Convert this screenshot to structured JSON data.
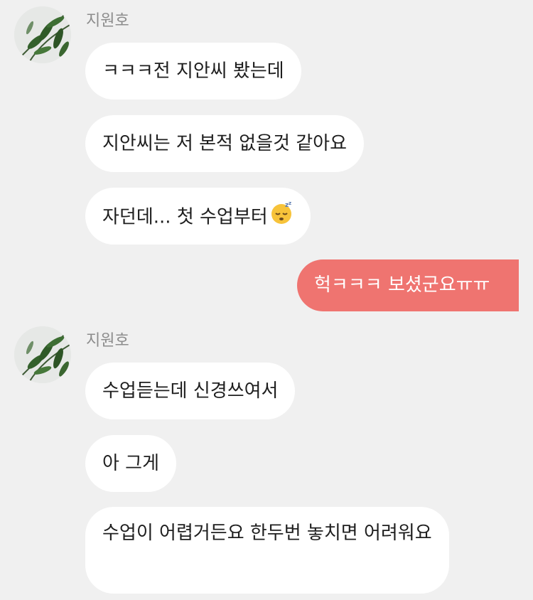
{
  "colors": {
    "background": "#f0f0f0",
    "incoming_bubble": "#ffffff",
    "outgoing_bubble": "#ef7470",
    "name_text": "#8c8c8c"
  },
  "groups": [
    {
      "sender": "지원호",
      "avatar_icon": "plant-leaves-avatar",
      "messages": [
        "ㅋㅋㅋ전 지안씨 봤는데",
        "지안씨는 저 본적 없을것 같아요",
        "자던데... 첫 수업부터",
        "헉ㅋㅋㅋ 보셨군요ㅠㅠ"
      ]
    },
    {
      "sender": "지원호",
      "avatar_icon": "plant-leaves-avatar",
      "messages": [
        "수업듣는데 신경쓰여서",
        "아 그게",
        "수업이 어렵거든요 한두번 놓치면 어려워요"
      ]
    }
  ],
  "sleeping_emoji": "sleeping-face-icon"
}
